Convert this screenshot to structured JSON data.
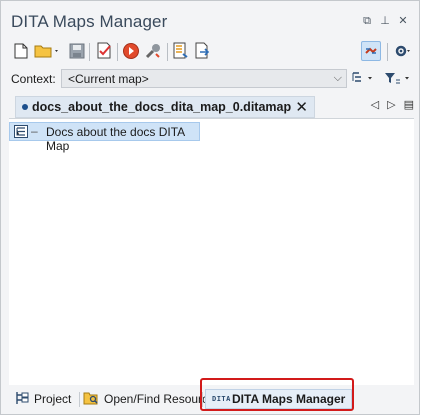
{
  "window": {
    "title": "DITA Maps Manager",
    "buttons": [
      "restore-icon",
      "pin-icon",
      "close-icon"
    ]
  },
  "toolbar": {
    "items": [
      {
        "name": "new-icon"
      },
      {
        "name": "open-icon"
      },
      {
        "name": "save-icon"
      },
      {
        "name": "validate-icon"
      },
      {
        "name": "apply-transformation-icon"
      },
      {
        "name": "configure-transformation-icon"
      },
      {
        "name": "open-map-in-editor-icon"
      },
      {
        "name": "export-map-icon"
      },
      {
        "name": "link-with-editor-icon"
      },
      {
        "name": "settings-icon"
      }
    ]
  },
  "context": {
    "label": "Context:",
    "value": "<Current map>"
  },
  "tab": {
    "label": "docs_about_the_docs_dita_map_0.ditamap",
    "close": "✕"
  },
  "tree": {
    "items": [
      {
        "dash": "–",
        "label": "Docs about the docs DITA Map"
      }
    ]
  },
  "bottom_tabs": [
    {
      "label": "Project"
    },
    {
      "label": "Open/Find Resource"
    },
    {
      "label": "DITA Maps Manager",
      "icon_text": "DITA"
    }
  ],
  "colors": {
    "highlight": "#d21a1a",
    "selection": "#cfe3f7",
    "title": "#3a4a5c"
  }
}
